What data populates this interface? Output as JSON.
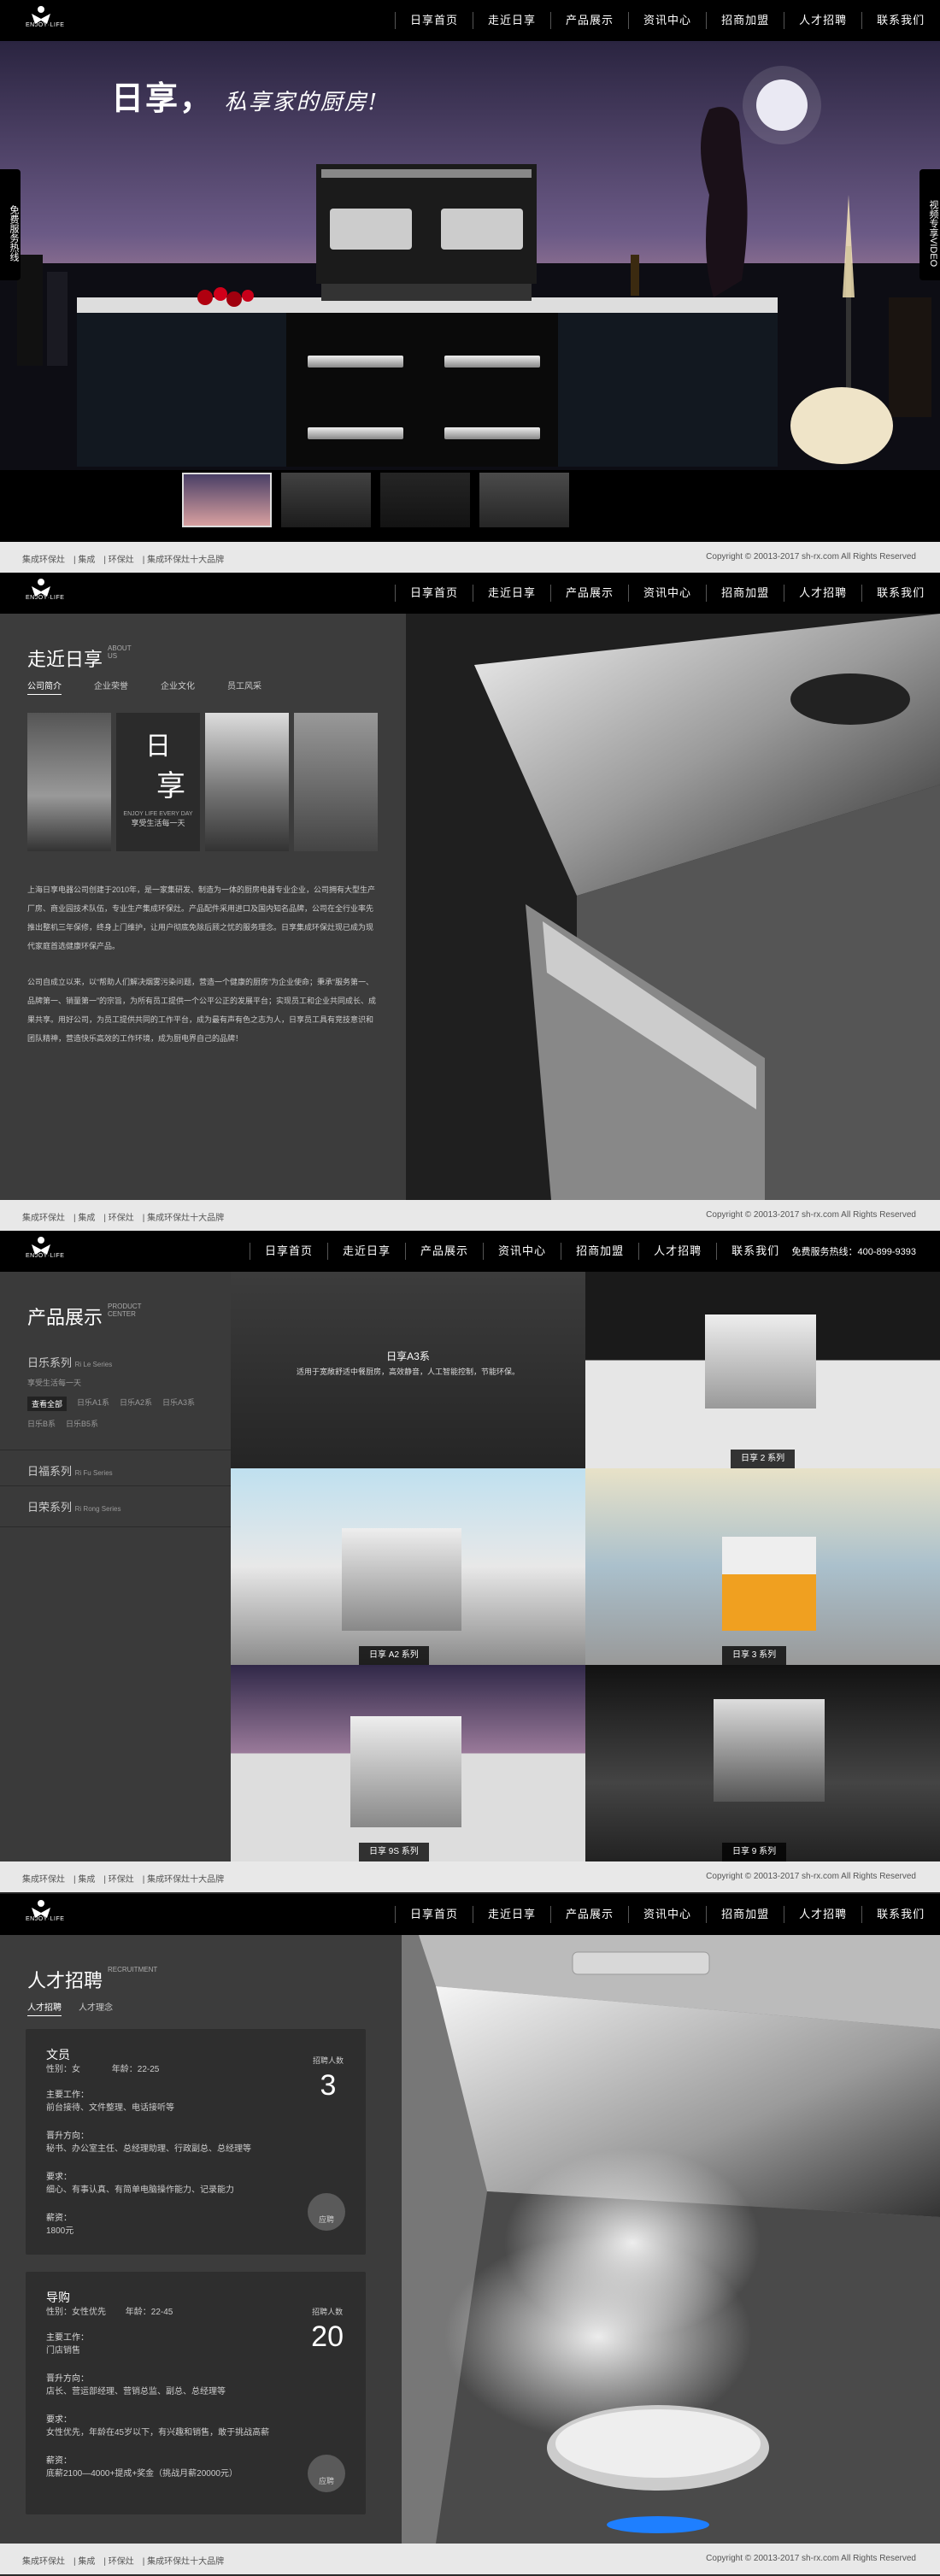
{
  "nav": {
    "items": [
      "日享首页",
      "走近日享",
      "产品展示",
      "资讯中心",
      "招商加盟",
      "人才招聘",
      "联系我们"
    ],
    "logo_text": "ENJOY·LIFE",
    "hotline": "免费服务热线：400-899-9393"
  },
  "footer": {
    "links": [
      "集成环保灶",
      "集成",
      "环保灶",
      "集成环保灶十大品牌"
    ],
    "copyright": "Copyright © 20013-2017 sh-rx.com All Rights Reserved"
  },
  "hero": {
    "headline": "日享，",
    "subline": "私享家的厨房!",
    "left_tab": "免费服务热线",
    "right_tab": "视频专享VIDEO"
  },
  "about": {
    "title": "走近日享",
    "title_en": "ABOUT US",
    "tabs": [
      "公司简介",
      "企业荣誉",
      "企业文化",
      "员工风采"
    ],
    "active_tab": 0,
    "brand_big": "日",
    "brand_big2": "享",
    "brand_en": "ENJOY LIFE EVERY DAY",
    "brand_slogan": "享受生活每一天",
    "para1": "上海日享电器公司创建于2010年，是一家集研发、制造为一体的厨房电器专业企业，公司拥有大型生产厂房、商业园技术队伍，专业生产集成环保灶。产品配件采用进口及国内知名品牌，公司在全行业率先推出整机三年保修，终身上门维护，让用户彻底免除后顾之忧的服务理念。日享集成环保灶现已成为现代家庭首选健康环保产品。",
    "para2": "公司自成立以来，以“帮助人们解决烟雾污染问题，营造一个健康的厨房”为企业使命；秉承“服务第一、品牌第一、销量第一”的宗旨，为所有员工提供一个公平公正的发展平台；实现员工和企业共同成长、成果共享。用好公司，为员工提供共同的工作平台，成为最有声有色之志为人，日享员工具有竞技意识和团队精神，营造快乐高效的工作环境，成为厨电界自己的品牌！"
  },
  "products": {
    "title": "产品展示",
    "title_en": "PRODUCT CENTER",
    "series": [
      {
        "name": "日乐系列",
        "en": "Ri Le Series",
        "desc": "享受生活每一天",
        "subs": [
          "查看全部",
          "日乐A1系",
          "日乐A2系",
          "日乐A3系",
          "日乐B系",
          "日乐B5系"
        ]
      },
      {
        "name": "日福系列",
        "en": "Ri Fu Series"
      },
      {
        "name": "日荣系列",
        "en": "Ri Rong Series"
      }
    ],
    "featured": {
      "name": "日享A3系",
      "desc": "适用于宽敞舒适中餐厨房，高效静音，人工智能控制，节能环保。"
    },
    "tiles": [
      "日享 2 系列",
      "日享 A2 系列",
      "日享 3 系列",
      "日享 9S 系列",
      "日享 9 系列"
    ]
  },
  "jobs": {
    "title": "人才招聘",
    "title_en": "RECRUITMENT",
    "tabs": [
      "人才招聘",
      "人才理念"
    ],
    "active_tab": 0,
    "count_label": "招聘人数",
    "apply_label": "应聘",
    "list": [
      {
        "title": "文员",
        "gender_label": "性别：",
        "gender": "女",
        "age_label": "年龄：",
        "age": "22-25",
        "work_label": "主要工作：",
        "work": "前台接待、文件整理、电话接听等",
        "promo_label": "晋升方向：",
        "promo": "秘书、办公室主任、总经理助理、行政副总、总经理等",
        "req_label": "要求：",
        "req": "细心、有事认真、有简单电脑操作能力、记录能力",
        "salary_label": "薪资：",
        "salary": "1800元",
        "count": "3"
      },
      {
        "title": "导购",
        "gender_label": "性别：",
        "gender": "女性优先",
        "age_label": "年龄：",
        "age": "22-45",
        "work_label": "主要工作：",
        "work": "门店销售",
        "promo_label": "晋升方向：",
        "promo": "店长、营运部经理、营销总监、副总、总经理等",
        "req_label": "要求：",
        "req": "女性优先，年龄在45岁以下，有兴趣和销售，敢于挑战高薪",
        "salary_label": "薪资：",
        "salary": "底薪2100—4000+提成+奖金（挑战月薪20000元）",
        "count": "20"
      }
    ]
  },
  "colors": {
    "accent": "#000000",
    "panel": "#3c3c3c",
    "footer": "#e8e8e8",
    "orange": "#f0a020"
  }
}
